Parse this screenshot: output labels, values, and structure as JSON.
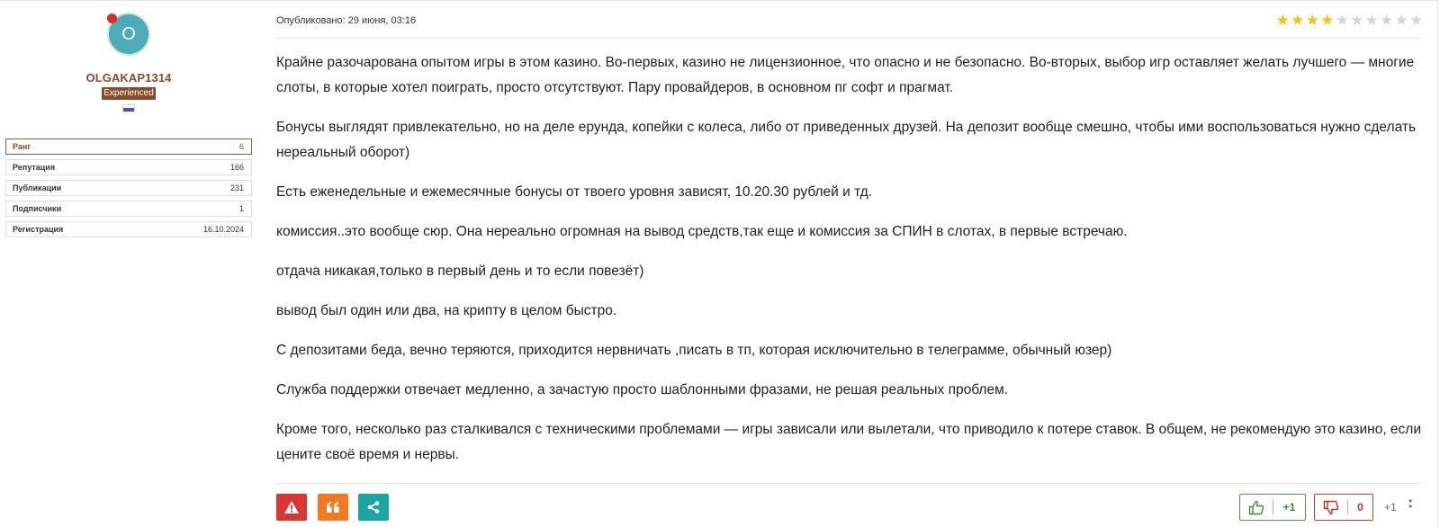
{
  "author": {
    "avatar_letter": "O",
    "username": "OLGAKAP1314",
    "rank_badge": "Experienced",
    "flag_icon": "russia-flag-icon",
    "online": true,
    "stats": [
      {
        "label": "Ранг",
        "value": "6"
      },
      {
        "label": "Репутация",
        "value": "166"
      },
      {
        "label": "Публикации",
        "value": "231"
      },
      {
        "label": "Подписчики",
        "value": "1"
      },
      {
        "label": "Регистрация",
        "value": "16.10.2024"
      }
    ]
  },
  "post": {
    "published": "Опубликовано: 29 июня, 03:16",
    "rating": {
      "value": 4,
      "max": 10
    },
    "paragraphs": [
      "Крайне разочарована опытом игры в этом казино. Во-первых, казино не лицензионное, что опасно и не безопасно. Во-вторых, выбор игр оставляет желать лучшего — многие слоты, в которые хотел поиграть, просто отсутствуют. Пару провайдеров, в основном пг софт и прагмат.",
      "Бонусы выглядят привлекательно, но на деле ерунда, копейки с колеса, либо от приведенных друзей. На депозит вообще смешно, чтобы ими воспользоваться нужно сделать нереальный оборот)",
      "Есть еженедельные и ежемесячные бонусы от твоего уровня зависят, 10.20.30 рублей и тд.",
      "комиссия..это вообще сюр. Она нереально огромная на вывод средств,так еще и комиссия за СПИН в слотах, в первые встречаю.",
      "отдача никакая,только в первый день и то если повезёт)",
      "вывод был один или два, на крипту в целом быстро.",
      "С депозитами беда, вечно теряются, приходится нервничать ,писать в тп,  которая исключительно в телеграмме, обычный юзер)",
      "Служба поддержки отвечает медленно, а зачастую просто шаблонными фразами, не решая реальных проблем.",
      "Кроме того, несколько раз сталкивался с техническими проблемами — игры зависали или вылетали, что приводило к потере ставок. В общем, не рекомендую это казино, если цените своё время и нервы."
    ]
  },
  "actions": {
    "report_icon": "warning-icon",
    "quote_icon": "quote-icon",
    "share_icon": "share-icon"
  },
  "votes": {
    "up_count": "+1",
    "down_count": "0",
    "total": "+1"
  },
  "colors": {
    "brand_brown": "#8a4b2a",
    "star_on": "#f3c213",
    "report": "#d93535",
    "quote": "#f07922",
    "share": "#1aa5a0",
    "vote_up": "#48a33a",
    "vote_down": "#d23b3b"
  }
}
